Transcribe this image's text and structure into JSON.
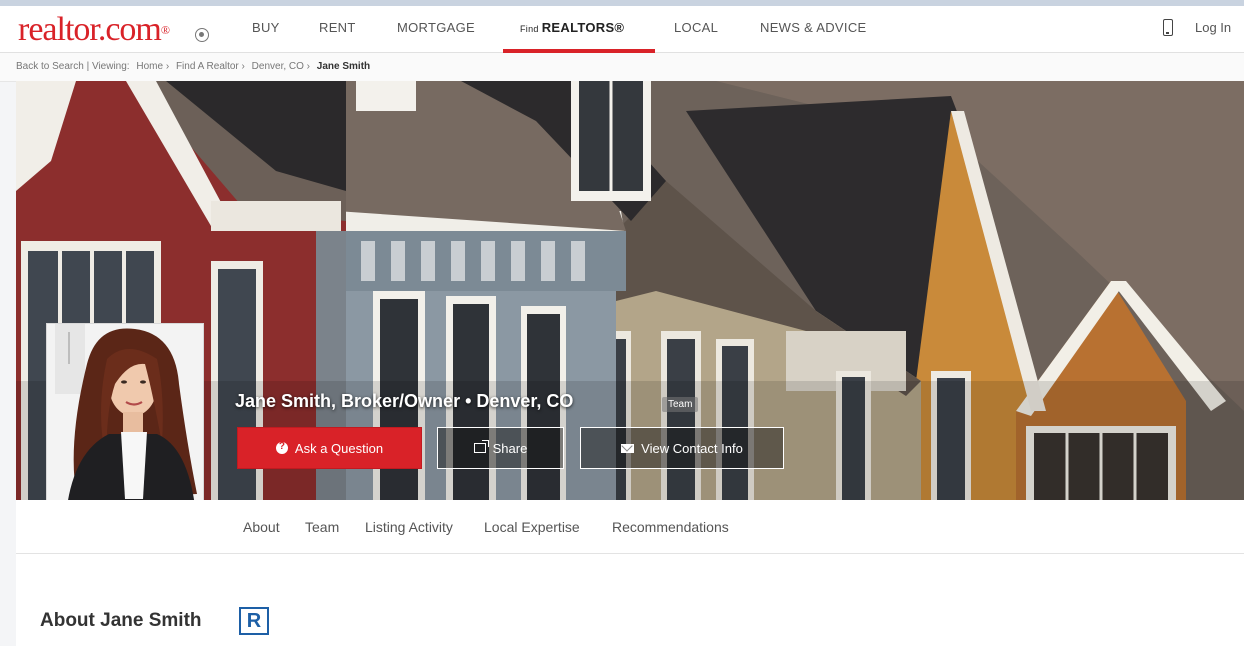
{
  "brand": {
    "logo_text": "realtor.com",
    "logo_reg": "®",
    "accent_color": "#d92228"
  },
  "nav": {
    "items": [
      {
        "label": "BUY"
      },
      {
        "label": "RENT"
      },
      {
        "label": "MORTGAGE"
      },
      {
        "label_small": "Find",
        "label": "REALTORS®",
        "active": true
      },
      {
        "label": "LOCAL"
      },
      {
        "label": "NEWS & ADVICE"
      }
    ],
    "login_label": "Log In",
    "phone_icon": "phone-icon"
  },
  "breadcrumb": {
    "back_label": "Back to Search | Viewing:",
    "items": [
      "Home ›",
      "Find A Realtor ›",
      "Denver, CO ›"
    ],
    "current": "Jane Smith"
  },
  "agent": {
    "headline": "Jane Smith, Broker/Owner • Denver, CO",
    "badge": "Team"
  },
  "actions": {
    "ask_label": "Ask a Question",
    "share_label": "Share",
    "contact_label": "View Contact Info"
  },
  "tabs": [
    "About",
    "Team",
    "Listing Activity",
    "Local Expertise",
    "Recommendations"
  ],
  "about": {
    "title": "About Jane Smith",
    "badge_letter": "R"
  }
}
